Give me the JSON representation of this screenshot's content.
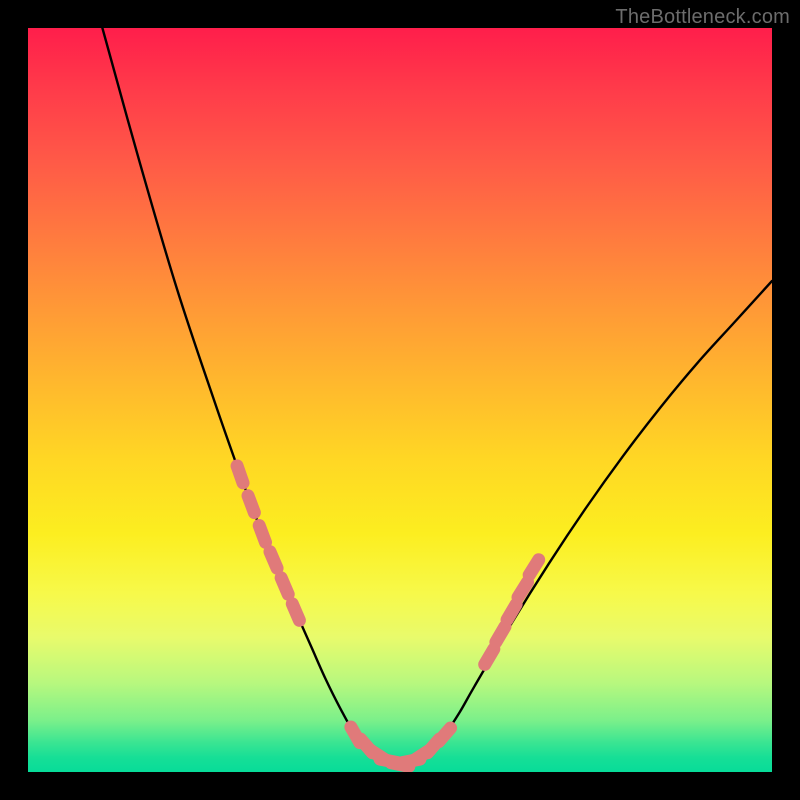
{
  "watermark": "TheBottleneck.com",
  "colors": {
    "frame": "#000000",
    "curve": "#000000",
    "markers": "#e07a7a",
    "gradient_top": "#ff1e4b",
    "gradient_bottom": "#07dc99"
  },
  "chart_data": {
    "type": "line",
    "title": "",
    "xlabel": "",
    "ylabel": "",
    "xlim": [
      0,
      100
    ],
    "ylim": [
      0,
      100
    ],
    "grid": false,
    "legend": false,
    "note": "Axes unlabeled; values estimated from pixel positions on a 0–100 normalized scale. y=0 at bottom.",
    "series": [
      {
        "name": "curve",
        "x": [
          10,
          15,
          20,
          25,
          28.5,
          30,
          31.5,
          33,
          34.5,
          36,
          38,
          40,
          42,
          44,
          46,
          48,
          50,
          52,
          54,
          56,
          58,
          60,
          65,
          70,
          75,
          80,
          85,
          90,
          95,
          100
        ],
        "y": [
          100,
          82,
          65,
          50,
          40,
          36,
          32,
          28.5,
          25,
          21.5,
          17,
          12.5,
          8.5,
          5,
          2.7,
          1.4,
          1,
          1.4,
          2.7,
          5,
          8,
          11.5,
          20,
          28,
          35.5,
          42.5,
          49,
          55,
          60.5,
          66
        ],
        "color": "#000000"
      }
    ],
    "markers": {
      "name": "dots",
      "color": "#e07a7a",
      "points": [
        {
          "x": 28.5,
          "y": 40
        },
        {
          "x": 30.0,
          "y": 36
        },
        {
          "x": 31.5,
          "y": 32
        },
        {
          "x": 33.0,
          "y": 28.5
        },
        {
          "x": 34.5,
          "y": 25
        },
        {
          "x": 36.0,
          "y": 21.5
        },
        {
          "x": 44.0,
          "y": 5
        },
        {
          "x": 45.5,
          "y": 3.5
        },
        {
          "x": 47.0,
          "y": 2.3
        },
        {
          "x": 48.5,
          "y": 1.5
        },
        {
          "x": 50.0,
          "y": 1.0
        },
        {
          "x": 51.5,
          "y": 1.5
        },
        {
          "x": 53.0,
          "y": 2.3
        },
        {
          "x": 54.5,
          "y": 3.5
        },
        {
          "x": 56.0,
          "y": 5.0
        },
        {
          "x": 62.0,
          "y": 15.5
        },
        {
          "x": 63.5,
          "y": 18.5
        },
        {
          "x": 65.0,
          "y": 21.5
        },
        {
          "x": 66.5,
          "y": 24.5
        },
        {
          "x": 68.0,
          "y": 27.5
        }
      ]
    }
  }
}
